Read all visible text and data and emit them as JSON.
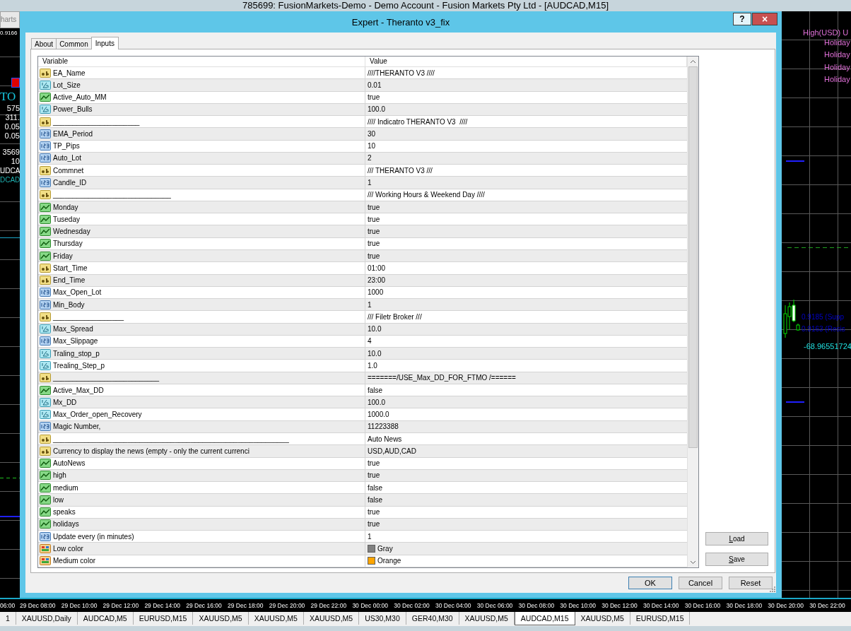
{
  "terminal": {
    "title": "785699: FusionMarkets-Demo - Demo Account - Fusion Markets Pty Ltd - [AUDCAD,M15]"
  },
  "left_chart": {
    "toolbar_tab": "harts",
    "price": "0.9166",
    "title": "TO",
    "values": [
      "575",
      "311.",
      "0.05",
      "0.05",
      "3569",
      "10"
    ],
    "symbols": [
      "UDCA",
      "DCAD"
    ]
  },
  "right_chart": {
    "news_header": "High(USD) U",
    "news_items": [
      "Holiday",
      "Holiday",
      "Holiday",
      "Holiday"
    ],
    "levels": [
      "0.9185 (Supp",
      "0.9163 (Resis"
    ],
    "reading": "-68.96551724"
  },
  "dialog": {
    "title": "Expert - Theranto v3_fix",
    "help": "?",
    "close": "×",
    "tabs": [
      {
        "label": "About",
        "selected": false
      },
      {
        "label": "Common",
        "selected": false
      },
      {
        "label": "Inputs",
        "selected": true
      }
    ],
    "table": {
      "columns": [
        "Variable",
        "Value"
      ],
      "rows": [
        {
          "kind": "string",
          "variable": "EA_Name",
          "value": "////THERANTO V3 ////"
        },
        {
          "kind": "double",
          "variable": "Lot_Size",
          "value": "0.01"
        },
        {
          "kind": "bool",
          "variable": "Active_Auto_MM",
          "value": "true"
        },
        {
          "kind": "double",
          "variable": "Power_Bulls",
          "value": "100.0"
        },
        {
          "kind": "string",
          "variable": "______________________",
          "value": "//// Indicatro THERANTO V3  ////"
        },
        {
          "kind": "int",
          "variable": "EMA_Period",
          "value": "30"
        },
        {
          "kind": "int",
          "variable": "TP_Pips",
          "value": "10"
        },
        {
          "kind": "int",
          "variable": "Auto_Lot",
          "value": "2"
        },
        {
          "kind": "string",
          "variable": "Commnet",
          "value": "/// THERANTO V3 ///"
        },
        {
          "kind": "int",
          "variable": "Candle_ID",
          "value": "1"
        },
        {
          "kind": "string",
          "variable": "______________________________",
          "value": "/// Working Hours & Weekend Day ////"
        },
        {
          "kind": "bool",
          "variable": "Monday",
          "value": "true"
        },
        {
          "kind": "bool",
          "variable": "Tuseday",
          "value": "true"
        },
        {
          "kind": "bool",
          "variable": "Wednesday",
          "value": "true"
        },
        {
          "kind": "bool",
          "variable": "Thursday",
          "value": "true"
        },
        {
          "kind": "bool",
          "variable": "Friday",
          "value": "true"
        },
        {
          "kind": "string",
          "variable": "Start_Time",
          "value": "01:00"
        },
        {
          "kind": "string",
          "variable": "End_Time",
          "value": "23:00"
        },
        {
          "kind": "int",
          "variable": "Max_Open_Lot",
          "value": "1000"
        },
        {
          "kind": "int",
          "variable": "Min_Body",
          "value": "1"
        },
        {
          "kind": "string",
          "variable": "__________________",
          "value": "/// Filetr Broker ///"
        },
        {
          "kind": "double",
          "variable": "Max_Spread",
          "value": "10.0"
        },
        {
          "kind": "int",
          "variable": "Max_Slippage",
          "value": "4"
        },
        {
          "kind": "double",
          "variable": "Traling_stop_p",
          "value": "10.0"
        },
        {
          "kind": "double",
          "variable": "Trealing_Step_p",
          "value": "1.0"
        },
        {
          "kind": "string",
          "variable": "___________________________",
          "value": "=======/USE_Max_DD_FOR_FTMO /======"
        },
        {
          "kind": "bool",
          "variable": "Active_Max_DD",
          "value": "false"
        },
        {
          "kind": "double",
          "variable": "Mx_DD",
          "value": "100.0"
        },
        {
          "kind": "double",
          "variable": "Max_Order_open_Recovery",
          "value": "1000.0"
        },
        {
          "kind": "int",
          "variable": "Magic Number,",
          "value": "11223388"
        },
        {
          "kind": "string",
          "variable": "____________________________________________________________",
          "value": "Auto News"
        },
        {
          "kind": "string",
          "variable": "Currency to display the news (empty - only the current currenci",
          "value": "USD,AUD,CAD"
        },
        {
          "kind": "bool",
          "variable": "AutoNews",
          "value": "true"
        },
        {
          "kind": "bool",
          "variable": "high",
          "value": "true"
        },
        {
          "kind": "bool",
          "variable": "medium",
          "value": "false"
        },
        {
          "kind": "bool",
          "variable": "low",
          "value": "false"
        },
        {
          "kind": "bool",
          "variable": "speaks",
          "value": "true"
        },
        {
          "kind": "bool",
          "variable": "holidays",
          "value": "true"
        },
        {
          "kind": "int",
          "variable": "Update every (in minutes)",
          "value": "1"
        },
        {
          "kind": "color",
          "variable": "Low color",
          "value": "Gray",
          "color": "#808080"
        },
        {
          "kind": "color",
          "variable": "Medium color",
          "value": "Orange",
          "color": "#ffa500"
        }
      ]
    },
    "side_buttons": [
      "Load",
      "Save"
    ],
    "footer_buttons": [
      "OK",
      "Cancel",
      "Reset"
    ]
  },
  "time_axis": [
    "06:00",
    "29 Dec 08:00",
    "29 Dec 10:00",
    "29 Dec 12:00",
    "29 Dec 14:00",
    "29 Dec 16:00",
    "29 Dec 18:00",
    "29 Dec 20:00",
    "29 Dec 22:00",
    "30 Dec 00:00",
    "30 Dec 02:00",
    "30 Dec 04:00",
    "30 Dec 06:00",
    "30 Dec 08:00",
    "30 Dec 10:00",
    "30 Dec 12:00",
    "30 Dec 14:00",
    "30 Dec 16:00",
    "30 Dec 18:00",
    "30 Dec 20:00",
    "30 Dec 22:00"
  ],
  "chart_tabs": [
    {
      "label": "1",
      "selected": false
    },
    {
      "label": "XAUUSD,Daily",
      "selected": false
    },
    {
      "label": "AUDCAD,M5",
      "selected": false
    },
    {
      "label": "EURUSD,M15",
      "selected": false
    },
    {
      "label": "XAUUSD,M5",
      "selected": false
    },
    {
      "label": "XAUUSD,M5",
      "selected": false
    },
    {
      "label": "XAUUSD,M5",
      "selected": false
    },
    {
      "label": "US30,M30",
      "selected": false
    },
    {
      "label": "GER40,M30",
      "selected": false
    },
    {
      "label": "XAUUSD,M5",
      "selected": false
    },
    {
      "label": "AUDCAD,M15",
      "selected": true
    },
    {
      "label": "XAUUSD,M5",
      "selected": false
    },
    {
      "label": "EURUSD,M15",
      "selected": false
    }
  ]
}
